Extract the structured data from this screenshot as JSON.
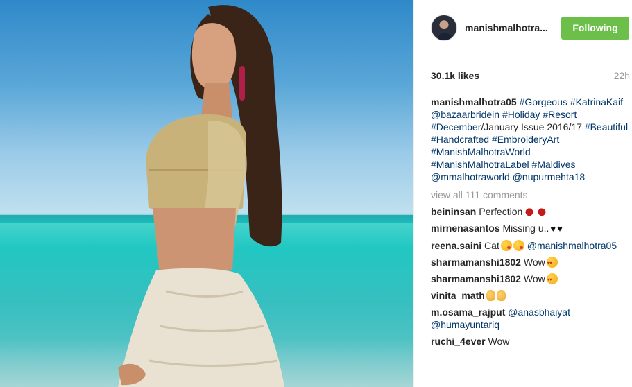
{
  "photo": {
    "alt_subject": "woman-portrait-beach"
  },
  "header": {
    "username": "manishmalhotra...",
    "follow_label": "Following",
    "follow_color": "#6cc04a"
  },
  "stats": {
    "likes": "30.1k likes",
    "time": "22h"
  },
  "caption": {
    "user": "manishmalhotra05",
    "parts": [
      {
        "t": "tag",
        "v": "#Gorgeous"
      },
      {
        "t": "tag",
        "v": "#KatrinaKaif"
      },
      {
        "t": "tag",
        "v": "@bazaarbridein"
      },
      {
        "t": "tag",
        "v": "#Holiday"
      },
      {
        "t": "tag",
        "v": "#Resort"
      },
      {
        "t": "tag",
        "v": "#December"
      },
      {
        "t": "plain",
        "v": "/January Issue 2016/17"
      },
      {
        "t": "tag",
        "v": "#Beautiful"
      },
      {
        "t": "tag",
        "v": "#Handcrafted"
      },
      {
        "t": "tag",
        "v": "#EmbroideryArt"
      },
      {
        "t": "tag",
        "v": "#ManishMalhotraWorld"
      },
      {
        "t": "tag",
        "v": "#ManishMalhotraLabel"
      },
      {
        "t": "tag",
        "v": "#Maldives"
      },
      {
        "t": "tag",
        "v": "@mmalhotraworld"
      },
      {
        "t": "tag",
        "v": "@nupurmehta18"
      }
    ]
  },
  "view_all": "view all 111 comments",
  "comments": [
    {
      "user": "beininsan",
      "text": "Perfection",
      "emoji": [
        "kiss",
        "kiss"
      ]
    },
    {
      "user": "mirnenasantos",
      "text": "Missing u..",
      "emoji": [
        "heart",
        "heart"
      ]
    },
    {
      "user": "reena.saini",
      "text": "Cat",
      "emoji": [
        "wink",
        "wink"
      ],
      "mention": "@manishmalhotra05"
    },
    {
      "user": "sharmamanshi1802",
      "text": "Wow",
      "emoji": [
        "love"
      ]
    },
    {
      "user": "sharmamanshi1802",
      "text": "Wow",
      "emoji": [
        "love"
      ]
    },
    {
      "user": "vinita_math",
      "text": "",
      "emoji": [
        "ok",
        "ok"
      ]
    },
    {
      "user": "m.osama_rajput",
      "text": "",
      "mention": "@anasbhaiyat @humayuntariq"
    },
    {
      "user": "ruchi_4ever",
      "text": "Wow",
      "emoji": []
    }
  ]
}
